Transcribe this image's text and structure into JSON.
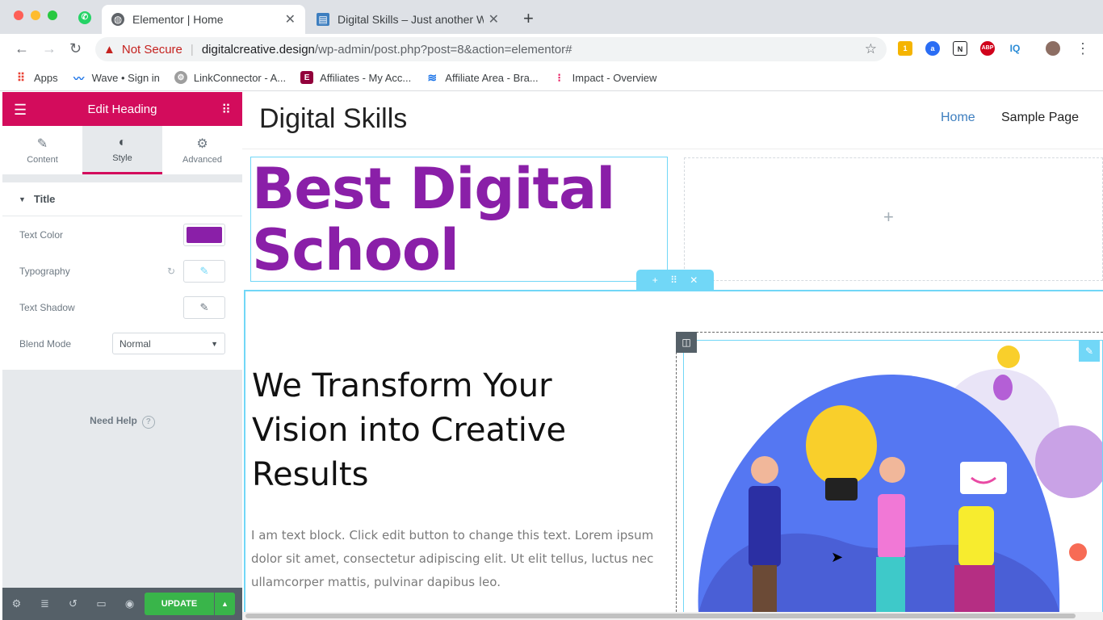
{
  "browser": {
    "tabs": [
      {
        "title": "Elementor | Home",
        "active": true
      },
      {
        "title": "Digital Skills – Just another Wo",
        "active": false
      }
    ],
    "address": {
      "security": "Not Secure",
      "host": "digitalcreative.design",
      "path": "/wp-admin/post.php?post=8&action=elementor#"
    },
    "extensions": [
      "1",
      "IQ",
      "ABP",
      "N"
    ],
    "bookmarks": [
      "Apps",
      "Wave • Sign in",
      "LinkConnector - A...",
      "Affiliates - My Acc...",
      "Affiliate Area - Bra...",
      "Impact - Overview"
    ]
  },
  "panel": {
    "title": "Edit Heading",
    "tabs": [
      "Content",
      "Style",
      "Advanced"
    ],
    "active_tab": "Style",
    "section": "Title",
    "controls": {
      "text_color_label": "Text Color",
      "text_color_value": "#8a1fa8",
      "typography_label": "Typography",
      "text_shadow_label": "Text Shadow",
      "blend_mode_label": "Blend Mode",
      "blend_mode_value": "Normal"
    },
    "need_help": "Need Help",
    "update_label": "UPDATE"
  },
  "canvas": {
    "site_title": "Digital Skills",
    "nav": [
      "Home",
      "Sample Page"
    ],
    "heading_line1": "Best Digital",
    "heading_line2": "School",
    "subheading": "We Transform Your Vision into Creative Results",
    "body_text": "I am text block. Click edit button to change this text. Lorem ipsum dolor sit amet, consectetur adipiscing elit. Ut elit tellus, luctus nec ullamcorper mattis, pulvinar dapibus leo."
  },
  "colors": {
    "elementor_accent": "#d30c5c",
    "heading_color": "#8a1fa8",
    "selection_blue": "#71d7f7",
    "update_green": "#39b54a",
    "nav_active": "#3d7ebf"
  }
}
